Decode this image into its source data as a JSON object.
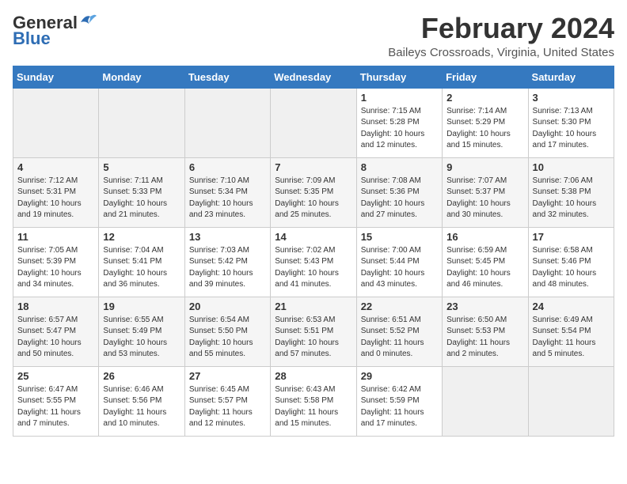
{
  "header": {
    "logo_general": "General",
    "logo_blue": "Blue",
    "month_year": "February 2024",
    "location": "Baileys Crossroads, Virginia, United States"
  },
  "weekdays": [
    "Sunday",
    "Monday",
    "Tuesday",
    "Wednesday",
    "Thursday",
    "Friday",
    "Saturday"
  ],
  "weeks": [
    [
      {
        "day": "",
        "info": ""
      },
      {
        "day": "",
        "info": ""
      },
      {
        "day": "",
        "info": ""
      },
      {
        "day": "",
        "info": ""
      },
      {
        "day": "1",
        "info": "Sunrise: 7:15 AM\nSunset: 5:28 PM\nDaylight: 10 hours\nand 12 minutes."
      },
      {
        "day": "2",
        "info": "Sunrise: 7:14 AM\nSunset: 5:29 PM\nDaylight: 10 hours\nand 15 minutes."
      },
      {
        "day": "3",
        "info": "Sunrise: 7:13 AM\nSunset: 5:30 PM\nDaylight: 10 hours\nand 17 minutes."
      }
    ],
    [
      {
        "day": "4",
        "info": "Sunrise: 7:12 AM\nSunset: 5:31 PM\nDaylight: 10 hours\nand 19 minutes."
      },
      {
        "day": "5",
        "info": "Sunrise: 7:11 AM\nSunset: 5:33 PM\nDaylight: 10 hours\nand 21 minutes."
      },
      {
        "day": "6",
        "info": "Sunrise: 7:10 AM\nSunset: 5:34 PM\nDaylight: 10 hours\nand 23 minutes."
      },
      {
        "day": "7",
        "info": "Sunrise: 7:09 AM\nSunset: 5:35 PM\nDaylight: 10 hours\nand 25 minutes."
      },
      {
        "day": "8",
        "info": "Sunrise: 7:08 AM\nSunset: 5:36 PM\nDaylight: 10 hours\nand 27 minutes."
      },
      {
        "day": "9",
        "info": "Sunrise: 7:07 AM\nSunset: 5:37 PM\nDaylight: 10 hours\nand 30 minutes."
      },
      {
        "day": "10",
        "info": "Sunrise: 7:06 AM\nSunset: 5:38 PM\nDaylight: 10 hours\nand 32 minutes."
      }
    ],
    [
      {
        "day": "11",
        "info": "Sunrise: 7:05 AM\nSunset: 5:39 PM\nDaylight: 10 hours\nand 34 minutes."
      },
      {
        "day": "12",
        "info": "Sunrise: 7:04 AM\nSunset: 5:41 PM\nDaylight: 10 hours\nand 36 minutes."
      },
      {
        "day": "13",
        "info": "Sunrise: 7:03 AM\nSunset: 5:42 PM\nDaylight: 10 hours\nand 39 minutes."
      },
      {
        "day": "14",
        "info": "Sunrise: 7:02 AM\nSunset: 5:43 PM\nDaylight: 10 hours\nand 41 minutes."
      },
      {
        "day": "15",
        "info": "Sunrise: 7:00 AM\nSunset: 5:44 PM\nDaylight: 10 hours\nand 43 minutes."
      },
      {
        "day": "16",
        "info": "Sunrise: 6:59 AM\nSunset: 5:45 PM\nDaylight: 10 hours\nand 46 minutes."
      },
      {
        "day": "17",
        "info": "Sunrise: 6:58 AM\nSunset: 5:46 PM\nDaylight: 10 hours\nand 48 minutes."
      }
    ],
    [
      {
        "day": "18",
        "info": "Sunrise: 6:57 AM\nSunset: 5:47 PM\nDaylight: 10 hours\nand 50 minutes."
      },
      {
        "day": "19",
        "info": "Sunrise: 6:55 AM\nSunset: 5:49 PM\nDaylight: 10 hours\nand 53 minutes."
      },
      {
        "day": "20",
        "info": "Sunrise: 6:54 AM\nSunset: 5:50 PM\nDaylight: 10 hours\nand 55 minutes."
      },
      {
        "day": "21",
        "info": "Sunrise: 6:53 AM\nSunset: 5:51 PM\nDaylight: 10 hours\nand 57 minutes."
      },
      {
        "day": "22",
        "info": "Sunrise: 6:51 AM\nSunset: 5:52 PM\nDaylight: 11 hours\nand 0 minutes."
      },
      {
        "day": "23",
        "info": "Sunrise: 6:50 AM\nSunset: 5:53 PM\nDaylight: 11 hours\nand 2 minutes."
      },
      {
        "day": "24",
        "info": "Sunrise: 6:49 AM\nSunset: 5:54 PM\nDaylight: 11 hours\nand 5 minutes."
      }
    ],
    [
      {
        "day": "25",
        "info": "Sunrise: 6:47 AM\nSunset: 5:55 PM\nDaylight: 11 hours\nand 7 minutes."
      },
      {
        "day": "26",
        "info": "Sunrise: 6:46 AM\nSunset: 5:56 PM\nDaylight: 11 hours\nand 10 minutes."
      },
      {
        "day": "27",
        "info": "Sunrise: 6:45 AM\nSunset: 5:57 PM\nDaylight: 11 hours\nand 12 minutes."
      },
      {
        "day": "28",
        "info": "Sunrise: 6:43 AM\nSunset: 5:58 PM\nDaylight: 11 hours\nand 15 minutes."
      },
      {
        "day": "29",
        "info": "Sunrise: 6:42 AM\nSunset: 5:59 PM\nDaylight: 11 hours\nand 17 minutes."
      },
      {
        "day": "",
        "info": ""
      },
      {
        "day": "",
        "info": ""
      }
    ]
  ]
}
